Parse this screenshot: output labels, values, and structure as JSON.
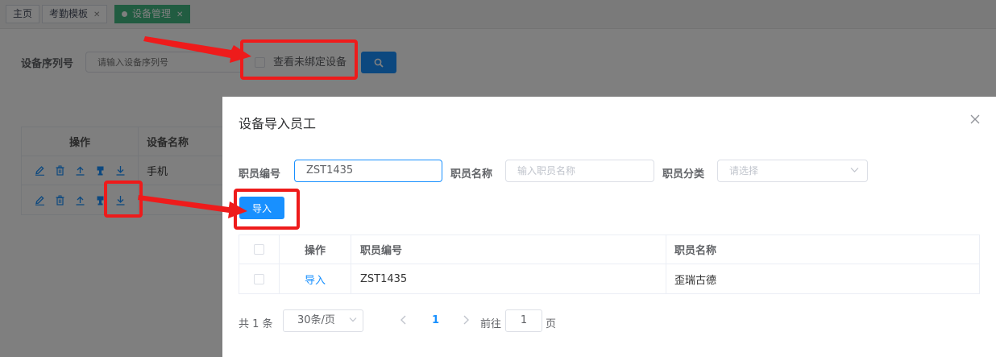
{
  "tabs": [
    {
      "label": "主页",
      "closable": false
    },
    {
      "label": "考勤模板",
      "closable": true
    },
    {
      "label": "设备管理",
      "closable": true,
      "active": true
    }
  ],
  "filter": {
    "serial_label": "设备序列号",
    "serial_placeholder": "请输入设备序列号",
    "unbound_checkbox": "查看未绑定设备"
  },
  "bg_table": {
    "headers": [
      "操作",
      "设备名称"
    ],
    "rows": [
      {
        "name": "手机"
      },
      {
        "name": ""
      }
    ]
  },
  "dialog": {
    "title": "设备导入员工",
    "emp_id_label": "职员编号",
    "emp_id_value": "ZST1435",
    "emp_name_label": "职员名称",
    "emp_name_placeholder": "输入职员名称",
    "emp_cat_label": "职员分类",
    "emp_cat_placeholder": "请选择",
    "import_button": "导入",
    "table": {
      "headers": [
        "操作",
        "职员编号",
        "职员名称"
      ],
      "rows": [
        {
          "action": "导入",
          "emp_id": "ZST1435",
          "emp_name": "歪瑞古德"
        }
      ]
    },
    "pagination": {
      "total": "共 1 条",
      "page_size": "30条/页",
      "current_page": "1",
      "goto_label": "前往",
      "goto_value": "1",
      "page_suffix": "页"
    }
  },
  "colors": {
    "primary": "#1890ff",
    "tab_active": "#42b983",
    "annotation": "#ee1b1b"
  }
}
